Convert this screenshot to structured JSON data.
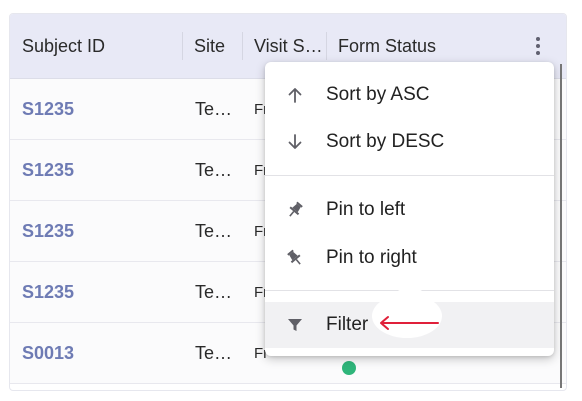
{
  "grid": {
    "columns": [
      "Subject ID",
      "Site",
      "Visit S…",
      "Form Status"
    ],
    "rows": [
      {
        "subject_id": "S1235",
        "site": "Te…",
        "visit": "Fr"
      },
      {
        "subject_id": "S1235",
        "site": "Te…",
        "visit": "Fr"
      },
      {
        "subject_id": "S1235",
        "site": "Te…",
        "visit": "Fr"
      },
      {
        "subject_id": "S1235",
        "site": "Te…",
        "visit": "Fr"
      },
      {
        "subject_id": "S0013",
        "site": "Te…",
        "visit": "Fr"
      }
    ]
  },
  "column_menu": {
    "items": [
      {
        "label": "Sort by ASC",
        "icon": "arrow-up-icon"
      },
      {
        "label": "Sort by DESC",
        "icon": "arrow-down-icon"
      },
      {
        "label": "Pin to left",
        "icon": "pin-icon"
      },
      {
        "label": "Pin to right",
        "icon": "pin-icon"
      },
      {
        "label": "Filter",
        "icon": "filter-icon"
      }
    ],
    "highlighted": "Filter"
  },
  "colors": {
    "header_bg": "#e8e9f6",
    "subject_link": "#6e7bb4",
    "status_dot": "#2fb57a",
    "annotation_arrow": "#e0203a"
  }
}
